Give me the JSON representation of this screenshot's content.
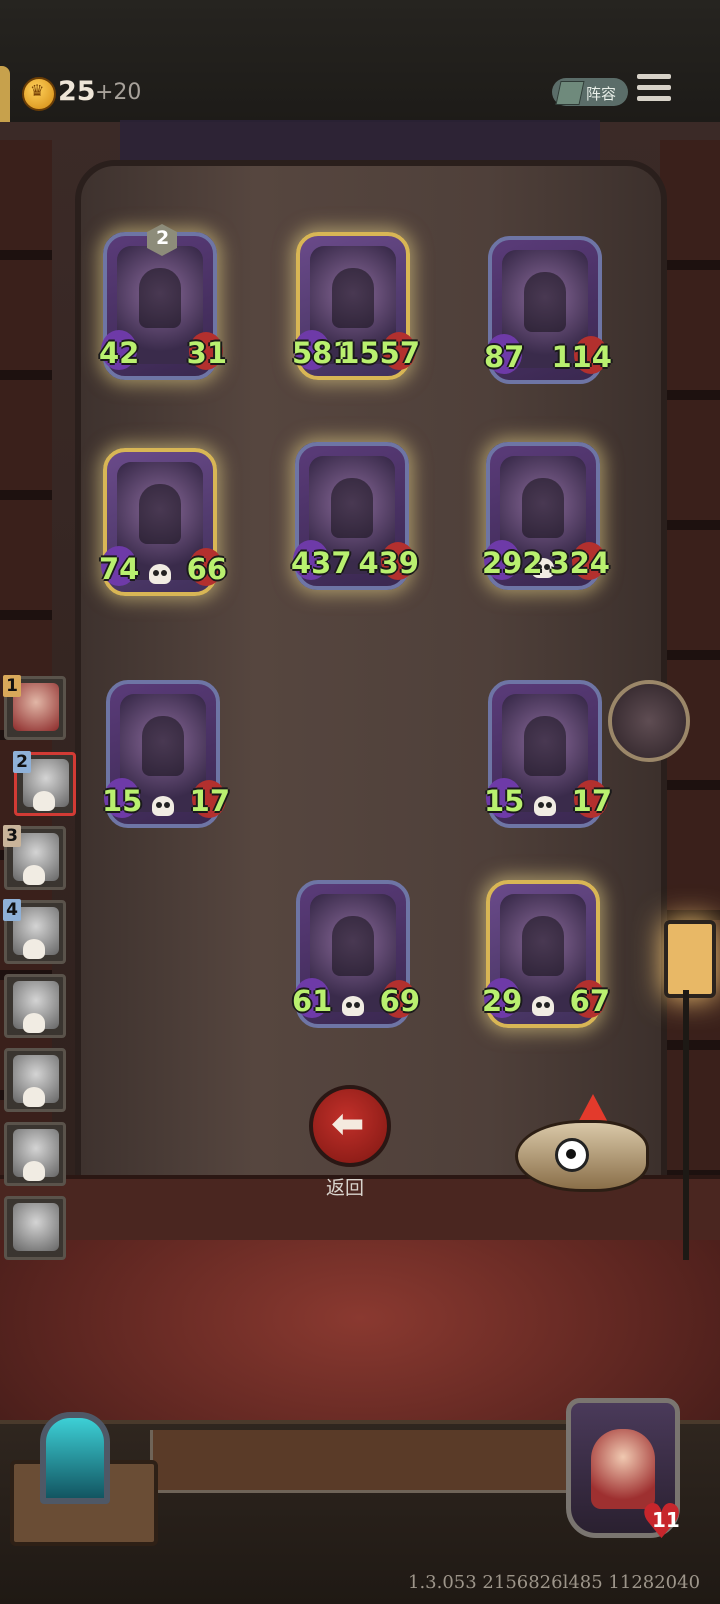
{
  "header": {
    "gold": "25",
    "gold_bonus": "+20",
    "lineup_label": "阵容"
  },
  "board": {
    "cards": [
      {
        "id": "card-1",
        "atk": "42",
        "hp": "31",
        "level": "2"
      },
      {
        "id": "card-2",
        "atk": "581",
        "hp": "1557"
      },
      {
        "id": "card-3",
        "atk": "87",
        "hp": "114"
      },
      {
        "id": "card-4",
        "atk": "74",
        "hp": "66"
      },
      {
        "id": "card-5",
        "atk": "437",
        "hp": "439"
      },
      {
        "id": "card-6",
        "atk": "292",
        "hp": "324"
      },
      {
        "id": "card-7",
        "atk": "15",
        "hp": "17"
      },
      {
        "id": "card-8",
        "atk": "15",
        "hp": "17"
      },
      {
        "id": "card-9",
        "atk": "61",
        "hp": "69"
      },
      {
        "id": "card-10",
        "atk": "29",
        "hp": "67"
      }
    ]
  },
  "roster": {
    "numbers": [
      "1",
      "2",
      "3",
      "4"
    ]
  },
  "back_label": "返回",
  "player": {
    "health": "11"
  },
  "version": "1.3.053 2156826l485 11282040"
}
